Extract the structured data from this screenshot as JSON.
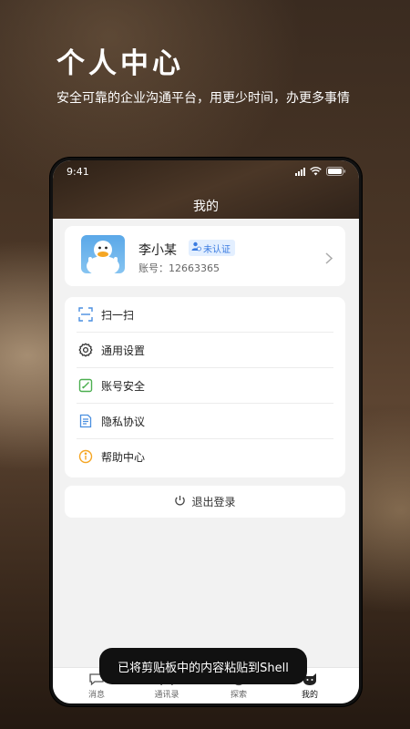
{
  "promo": {
    "title": "个人中心",
    "subtitle": "安全可靠的企业沟通平台，用更少时间，办更多事情"
  },
  "status_bar": {
    "time": "9:41"
  },
  "page": {
    "title": "我的"
  },
  "profile": {
    "name": "李小某",
    "certification_badge": "未认证",
    "account_label": "账号：",
    "account_number": "12663365"
  },
  "menu": {
    "items": [
      {
        "label": "扫一扫",
        "icon": "scan-icon"
      },
      {
        "label": "通用设置",
        "icon": "gear-icon"
      },
      {
        "label": "账号安全",
        "icon": "edit-icon"
      },
      {
        "label": "隐私协议",
        "icon": "document-icon"
      },
      {
        "label": "帮助中心",
        "icon": "info-icon"
      }
    ]
  },
  "logout": {
    "label": "退出登录"
  },
  "tab_bar": {
    "tabs": [
      {
        "label": "消息",
        "icon": "chat-icon"
      },
      {
        "label": "通讯录",
        "icon": "contacts-icon"
      },
      {
        "label": "探索",
        "icon": "explore-icon"
      },
      {
        "label": "我的",
        "icon": "profile-icon"
      }
    ]
  },
  "toast": {
    "text": "已将剪贴板中的内容粘贴到Shell"
  },
  "colors": {
    "accent_blue": "#3a7be0",
    "icon_green": "#4caf50",
    "icon_orange": "#f5a623",
    "icon_blue": "#4a8fe0"
  }
}
